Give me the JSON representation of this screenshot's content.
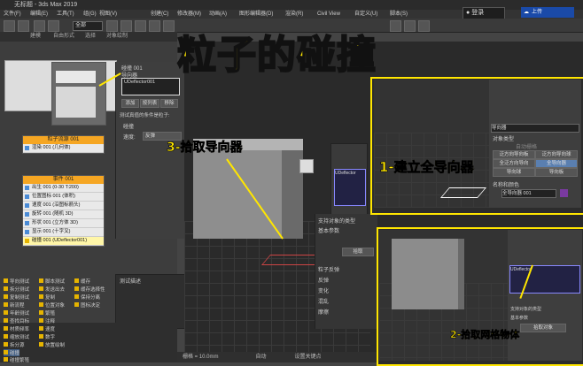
{
  "window": {
    "title": "无标题 - 3ds Max 2019"
  },
  "menu": [
    "文件(F)",
    "编辑(E)",
    "工具(T)",
    "组(G)",
    "视图(V)",
    "创建(C)",
    "修改器(M)",
    "动画(A)",
    "图形编辑器(D)",
    "渲染(R)",
    "Civil View",
    "自定义(U)",
    "脚本(S)"
  ],
  "toolbar": {
    "selection_filter": "全部"
  },
  "ribbon": {
    "tabs": [
      "建模",
      "自由形式",
      "选择",
      "对象绘制"
    ]
  },
  "account": {
    "login_label": "登录",
    "weiyun_label": "上传"
  },
  "banner": {
    "title": "粒子的碰撞"
  },
  "annotations": {
    "step1": "1-建立全导向器",
    "step2": "2-拾取网格物体",
    "step3": "3-拾取导向器"
  },
  "particle_view": {
    "panel_title": "碰撞 001",
    "deflector_field": "UDeflector001",
    "deflector_list_label": "导向器",
    "buttons": [
      "添加",
      "按列表",
      "移除"
    ],
    "test_label": "测试真值的条件是粒子:",
    "collision_label": "碰撞",
    "speed_label": "速度:",
    "speed_value": "反弹",
    "source_node": {
      "title": "粒子流源 001",
      "row": "渲染 001 (几何体)"
    },
    "event_node": {
      "title": "事件 001",
      "rows": [
        "出生 001 (0-30 T:200)",
        "位置图标 001 (体积)",
        "速度 001 (沿图标箭头)",
        "旋转 001 (随机 3D)",
        "形状 001 (立方体 3D)",
        "显示 001 (十字叉)",
        "碰撞 001 (UDeflector001)"
      ]
    },
    "description": "测试描述",
    "depot": [
      "导向测试",
      "拆分测试",
      "复制测试",
      "新流程",
      "年龄测试",
      "查找目标",
      "材质频率",
      "缩放测试",
      "拆分源",
      "繁殖",
      "查找目标",
      "脚本测试",
      "发送出去",
      "放置绘制",
      "碰撞",
      "碰撞繁殖",
      "复制",
      "数字",
      "位置对象",
      "保持分离",
      "缓存",
      "缓存选择性",
      "速度",
      "图标决定",
      "注释"
    ]
  },
  "command_panel_1": {
    "section": "导向器",
    "object_type": "对象类型",
    "auto_grid": "自动栅格",
    "buttons": [
      "泛方向导向板",
      "泛方向导向球",
      "全泛方向导向",
      "全导向器",
      "导向球",
      "导向板"
    ],
    "name_color": "名称和颜色",
    "name_value": "全导向器 001"
  },
  "command_panel_2": {
    "support": "支持对象的类型",
    "basic": "基本参数",
    "pick_label": "拾取对象",
    "field": "UDeflector"
  },
  "right_panel_mid": {
    "support": "支持对象的类型",
    "basic": "基本参数",
    "pick": "拾取",
    "particles": "粒子反弹",
    "rebound": "反弹",
    "variation": "变化",
    "chaos": "混乱",
    "friction": "摩擦"
  },
  "status": {
    "grid": "栅格 = 10.0mm",
    "auto": "自动",
    "set_key": "设置关键点"
  }
}
